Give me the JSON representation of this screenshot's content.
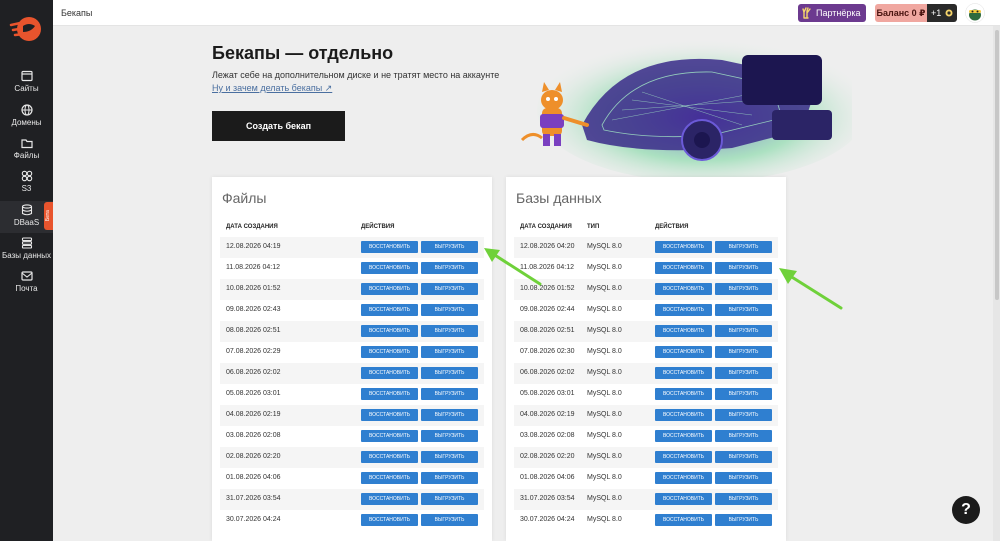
{
  "sidebar": {
    "items": [
      {
        "label": "Сайты",
        "icon": "sites-icon"
      },
      {
        "label": "Домены",
        "icon": "globe-icon"
      },
      {
        "label": "Файлы",
        "icon": "folder-icon"
      },
      {
        "label": "S3",
        "icon": "s3-icon"
      },
      {
        "label": "DBaaS",
        "icon": "database-icon"
      },
      {
        "label": "Базы данных",
        "icon": "database-stack-icon"
      },
      {
        "label": "Почта",
        "icon": "mail-icon"
      }
    ],
    "beta_label": "Бета"
  },
  "topbar": {
    "title": "Бекапы",
    "partner_label": "Партнёрка",
    "balance_label": "Баланс 0 ₽",
    "bonus_label": "+1"
  },
  "hero": {
    "title": "Бекапы — отдельно",
    "subtitle": "Лежат себе на дополнительном диске и не тратят место на аккаунте",
    "link": "Ну и зачем делать бекапы ↗",
    "create_label": "Создать бекап"
  },
  "files_panel": {
    "title": "Файлы",
    "columns": [
      "ДАТА СОЗДАНИЯ",
      "ДЕЙСТВИЯ"
    ],
    "restore_label": "ВОССТАНОВИТЬ",
    "download_label": "ВЫГРУЗИТЬ",
    "rows": [
      "12.08.2026 04:19",
      "11.08.2026 04:12",
      "10.08.2026 01:52",
      "09.08.2026 02:43",
      "08.08.2026 02:51",
      "07.08.2026 02:29",
      "06.08.2026 02:02",
      "05.08.2026 03:01",
      "04.08.2026 02:19",
      "03.08.2026 02:08",
      "02.08.2026 02:20",
      "01.08.2026 04:06",
      "31.07.2026 03:54",
      "30.07.2026 04:24"
    ]
  },
  "db_panel": {
    "title": "Базы данных",
    "columns": [
      "ДАТА СОЗДАНИЯ",
      "ТИП",
      "ДЕЙСТВИЯ"
    ],
    "restore_label": "ВОССТАНОВИТЬ",
    "download_label": "ВЫГРУЗИТЬ",
    "rows": [
      {
        "date": "12.08.2026 04:20",
        "type": "MySQL 8.0"
      },
      {
        "date": "11.08.2026 04:12",
        "type": "MySQL 8.0"
      },
      {
        "date": "10.08.2026 01:52",
        "type": "MySQL 8.0"
      },
      {
        "date": "09.08.2026 02:44",
        "type": "MySQL 8.0"
      },
      {
        "date": "08.08.2026 02:51",
        "type": "MySQL 8.0"
      },
      {
        "date": "07.08.2026 02:30",
        "type": "MySQL 8.0"
      },
      {
        "date": "06.08.2026 02:02",
        "type": "MySQL 8.0"
      },
      {
        "date": "05.08.2026 03:01",
        "type": "MySQL 8.0"
      },
      {
        "date": "04.08.2026 02:19",
        "type": "MySQL 8.0"
      },
      {
        "date": "03.08.2026 02:08",
        "type": "MySQL 8.0"
      },
      {
        "date": "02.08.2026 02:20",
        "type": "MySQL 8.0"
      },
      {
        "date": "01.08.2026 04:06",
        "type": "MySQL 8.0"
      },
      {
        "date": "31.07.2026 03:54",
        "type": "MySQL 8.0"
      },
      {
        "date": "30.07.2026 04:24",
        "type": "MySQL 8.0"
      }
    ]
  },
  "help_label": "?",
  "colors": {
    "action_blue": "#2f7fd0",
    "sidebar_bg": "#1f2023",
    "brand_orange": "#e8542d",
    "arrow_green": "#6fd13a"
  }
}
